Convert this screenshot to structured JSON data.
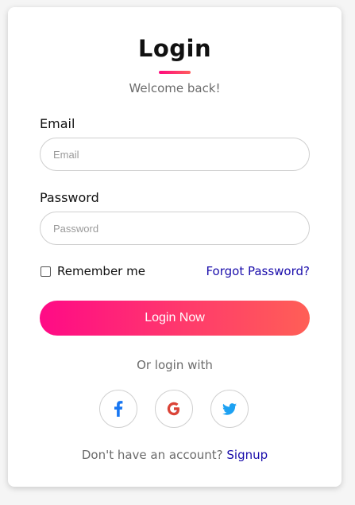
{
  "login": {
    "title": "Login",
    "subtitle": "Welcome back!",
    "email_label": "Email",
    "email_placeholder": "Email",
    "email_value": "",
    "password_label": "Password",
    "password_placeholder": "Password",
    "password_value": "",
    "remember_label": "Remember me",
    "remember_checked": false,
    "forgot_label": "Forgot Password?",
    "submit_label": "Login Now",
    "or_text": "Or login with",
    "social": [
      {
        "icon": "facebook-icon",
        "color": "#1877f2"
      },
      {
        "icon": "google-icon",
        "color": "#db4437"
      },
      {
        "icon": "twitter-icon",
        "color": "#1da1f2"
      }
    ],
    "signup_prompt": "Don't have an account?",
    "signup_link": "Signup"
  },
  "colors": {
    "accent_start": "#ff0a86",
    "accent_end": "#ff5f56",
    "link": "#1a0dab",
    "muted_text": "#6b6b6b"
  }
}
